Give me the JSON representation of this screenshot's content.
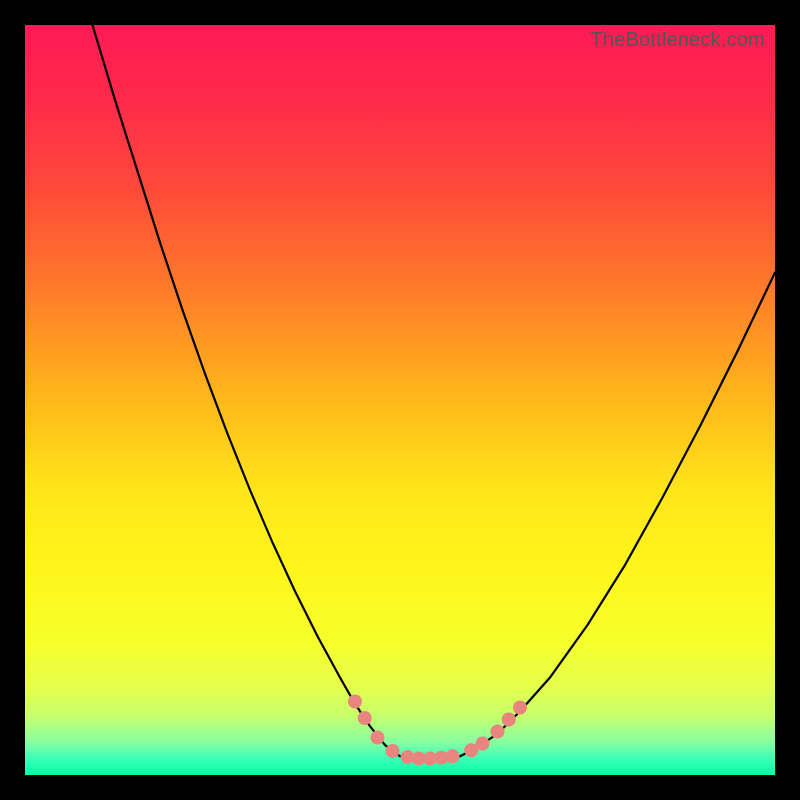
{
  "watermark": "TheBottleneck.com",
  "colors": {
    "frame": "#000000",
    "curve": "#000000",
    "marker_fill": "#e8857f",
    "marker_stroke": "#b85a55",
    "gradient_stops": [
      {
        "offset": 0.0,
        "color": "#ff1a55"
      },
      {
        "offset": 0.1,
        "color": "#ff2a4a"
      },
      {
        "offset": 0.22,
        "color": "#ff4a3a"
      },
      {
        "offset": 0.35,
        "color": "#ff7a2a"
      },
      {
        "offset": 0.5,
        "color": "#ffb81a"
      },
      {
        "offset": 0.62,
        "color": "#ffe51a"
      },
      {
        "offset": 0.72,
        "color": "#fff51a"
      },
      {
        "offset": 0.82,
        "color": "#f7ff2a"
      },
      {
        "offset": 0.88,
        "color": "#e5ff4a"
      },
      {
        "offset": 0.92,
        "color": "#c8ff6a"
      },
      {
        "offset": 0.955,
        "color": "#8affa0"
      },
      {
        "offset": 0.975,
        "color": "#45ffb5"
      },
      {
        "offset": 1.0,
        "color": "#00ffa8"
      }
    ]
  },
  "chart_data": {
    "type": "line",
    "title": "",
    "xlabel": "",
    "ylabel": "",
    "xlim": [
      0,
      100
    ],
    "ylim": [
      0,
      100
    ],
    "grid": false,
    "series": [
      {
        "name": "left-curve",
        "x": [
          9,
          12,
          15,
          18,
          21,
          24,
          27,
          30,
          33,
          36,
          39,
          42,
          44,
          46,
          48,
          50
        ],
        "y": [
          100,
          90,
          80.5,
          71,
          62,
          53.5,
          45.5,
          38,
          31,
          24.5,
          18.5,
          13,
          9.5,
          6.5,
          4,
          2.5
        ]
      },
      {
        "name": "right-curve",
        "x": [
          58,
          60,
          63,
          66,
          70,
          75,
          80,
          85,
          90,
          95,
          100
        ],
        "y": [
          2.5,
          3.5,
          5.5,
          8.5,
          13,
          20,
          28,
          37,
          46.5,
          56.5,
          67
        ]
      },
      {
        "name": "floor",
        "x": [
          50,
          52,
          54,
          56,
          58
        ],
        "y": [
          2.5,
          2.2,
          2.2,
          2.2,
          2.5
        ]
      }
    ],
    "markers": [
      {
        "x": 44.0,
        "y": 9.8
      },
      {
        "x": 45.3,
        "y": 7.6
      },
      {
        "x": 47.0,
        "y": 5.0
      },
      {
        "x": 49.0,
        "y": 3.2
      },
      {
        "x": 51.0,
        "y": 2.4
      },
      {
        "x": 52.5,
        "y": 2.2
      },
      {
        "x": 54.0,
        "y": 2.2
      },
      {
        "x": 55.5,
        "y": 2.3
      },
      {
        "x": 57.0,
        "y": 2.5
      },
      {
        "x": 59.5,
        "y": 3.3
      },
      {
        "x": 61.0,
        "y": 4.2
      },
      {
        "x": 63.0,
        "y": 5.8
      },
      {
        "x": 64.5,
        "y": 7.4
      },
      {
        "x": 66.0,
        "y": 9.0
      }
    ]
  }
}
